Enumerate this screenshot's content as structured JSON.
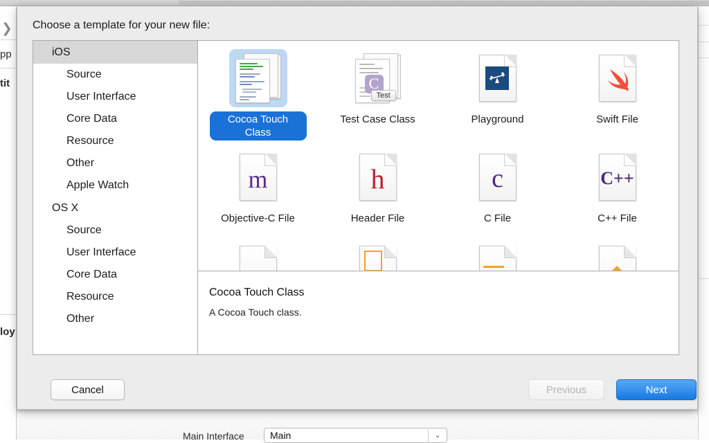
{
  "background": {
    "fragments": {
      "chevron": "❯",
      "app": "pp",
      "title": "tit",
      "deployment": "loy"
    },
    "bottom_bar": {
      "main_interface_label": "Main Interface",
      "main_interface_value": "Main",
      "chevron_icon": "⌄"
    }
  },
  "dialog": {
    "title": "Choose a template for your new file:",
    "sidebar": {
      "groups": [
        {
          "name": "iOS",
          "selected": true,
          "items": [
            "Source",
            "User Interface",
            "Core Data",
            "Resource",
            "Other",
            "Apple Watch"
          ]
        },
        {
          "name": "OS X",
          "selected": false,
          "items": [
            "Source",
            "User Interface",
            "Core Data",
            "Resource",
            "Other"
          ]
        }
      ]
    },
    "templates": {
      "rows": [
        [
          {
            "label": "Cocoa Touch Class",
            "icon": "cocoa-touch-class-icon",
            "selected": true
          },
          {
            "label": "Test Case Class",
            "icon": "test-case-class-icon",
            "selected": false
          },
          {
            "label": "Playground",
            "icon": "playground-icon",
            "selected": false
          },
          {
            "label": "Swift File",
            "icon": "swift-file-icon",
            "selected": false
          }
        ],
        [
          {
            "label": "Objective-C File",
            "icon": "objective-c-file-icon",
            "glyph": "m",
            "selected": false
          },
          {
            "label": "Header File",
            "icon": "header-file-icon",
            "glyph": "h",
            "selected": false
          },
          {
            "label": "C File",
            "icon": "c-file-icon",
            "glyph": "c",
            "selected": false
          },
          {
            "label": "C++ File",
            "icon": "cpp-file-icon",
            "glyph": "C++",
            "selected": false
          }
        ]
      ],
      "test_chip_label": "Test",
      "test_badge_glyph": "C"
    },
    "description": {
      "title": "Cocoa Touch Class",
      "body": "A Cocoa Touch class."
    },
    "footer": {
      "cancel_label": "Cancel",
      "previous_label": "Previous",
      "next_label": "Next"
    },
    "colors": {
      "selection_blue": "#1a72d8",
      "selection_tint": "#bcd8f3",
      "next_button_blue": "#1779e4",
      "swift_orange": "#f05138",
      "playground_blue": "#1b4a7e",
      "objc_purple": "#5b2d90",
      "header_red": "#b8232f"
    }
  }
}
